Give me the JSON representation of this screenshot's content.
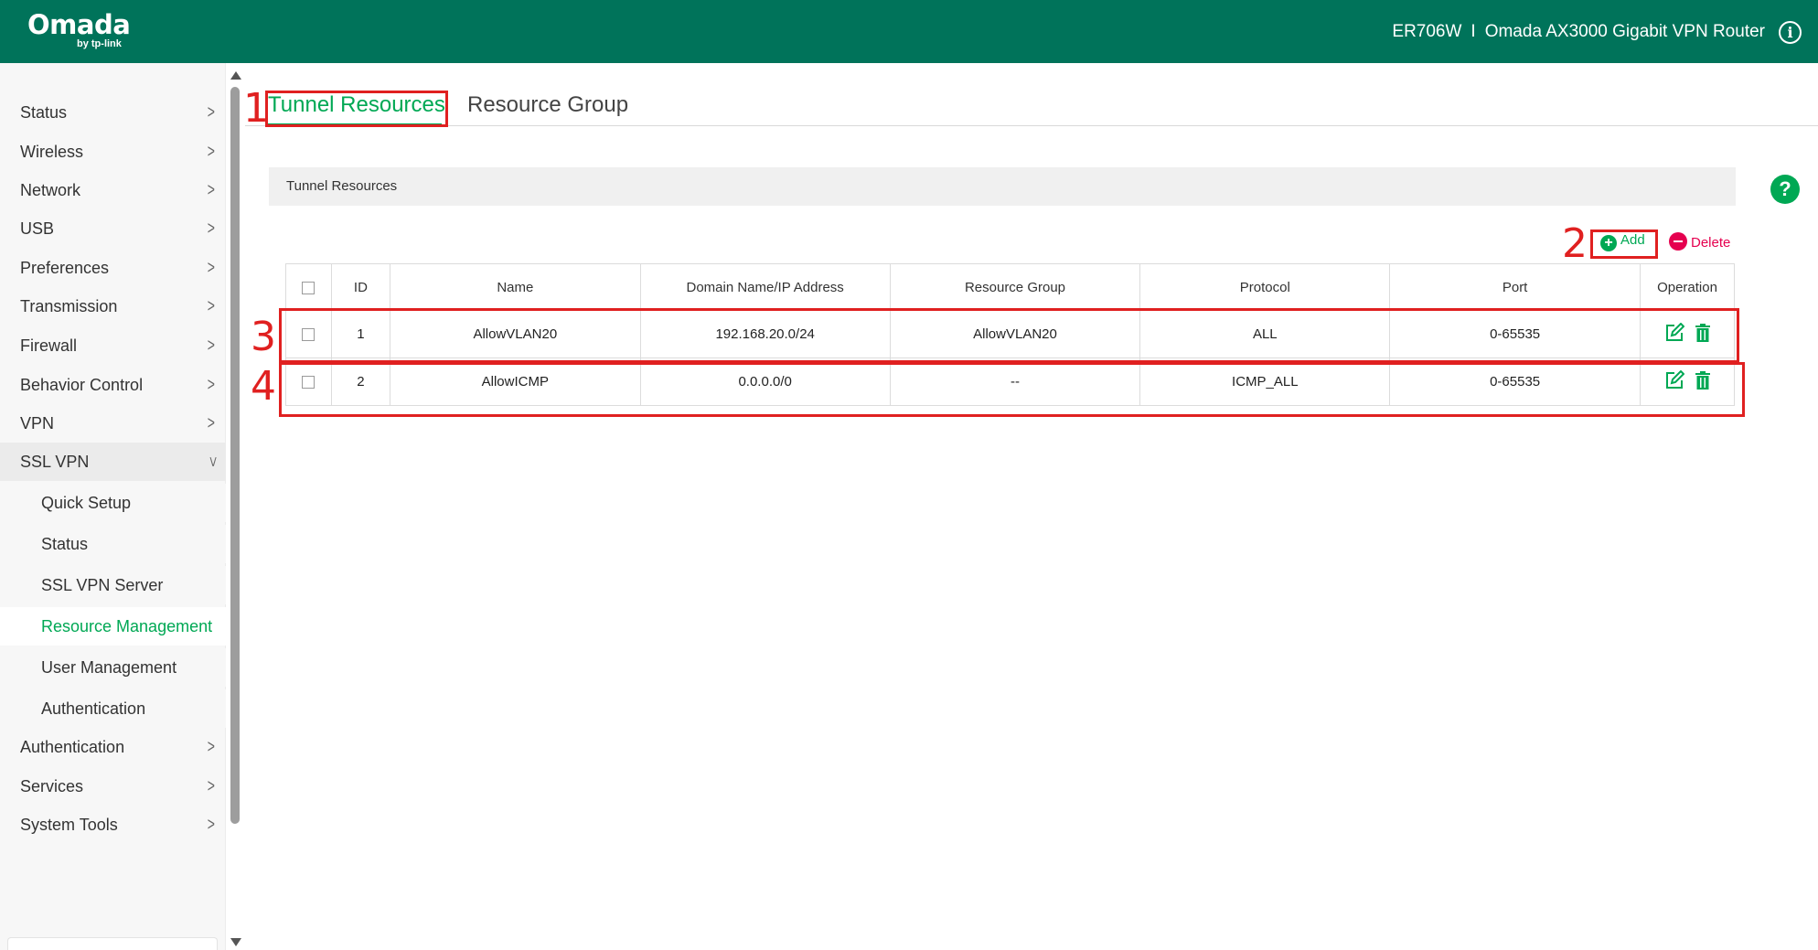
{
  "header": {
    "logo": "Omada",
    "logo_sub": "by tp-link",
    "model": "ER706W",
    "separator": "I",
    "device_name": "Omada AX3000 Gigabit VPN Router",
    "accent": "#00735a"
  },
  "sidebar": {
    "items": [
      {
        "label": "Status"
      },
      {
        "label": "Wireless"
      },
      {
        "label": "Network"
      },
      {
        "label": "USB"
      },
      {
        "label": "Preferences"
      },
      {
        "label": "Transmission"
      },
      {
        "label": "Firewall"
      },
      {
        "label": "Behavior Control"
      },
      {
        "label": "VPN"
      },
      {
        "label": "SSL VPN"
      }
    ],
    "sub_items": [
      {
        "label": "Quick Setup"
      },
      {
        "label": "Status"
      },
      {
        "label": "SSL VPN Server"
      },
      {
        "label": "Resource Management"
      },
      {
        "label": "User Management"
      },
      {
        "label": "Authentication"
      }
    ],
    "items_after": [
      {
        "label": "Authentication"
      },
      {
        "label": "Services"
      },
      {
        "label": "System Tools"
      }
    ],
    "active_sub": "Resource Management"
  },
  "tabs": [
    {
      "label": "Tunnel Resources",
      "active": true
    },
    {
      "label": "Resource Group",
      "active": false
    }
  ],
  "section": {
    "title": "Tunnel Resources",
    "add_label": "Add",
    "delete_label": "Delete"
  },
  "table": {
    "columns": [
      "ID",
      "Name",
      "Domain Name/IP Address",
      "Resource Group",
      "Protocol",
      "Port",
      "Operation"
    ],
    "rows": [
      {
        "id": "1",
        "name": "AllowVLAN20",
        "address": "192.168.20.0/24",
        "group": "AllowVLAN20",
        "protocol": "ALL",
        "port": "0-65535"
      },
      {
        "id": "2",
        "name": "AllowICMP",
        "address": "0.0.0.0/0",
        "group": "--",
        "protocol": "ICMP_ALL",
        "port": "0-65535"
      }
    ]
  },
  "annotations": [
    "1",
    "2",
    "3",
    "4"
  ],
  "colors": {
    "green": "#00a854",
    "red": "#e5004f",
    "annotation": "#e02020"
  }
}
